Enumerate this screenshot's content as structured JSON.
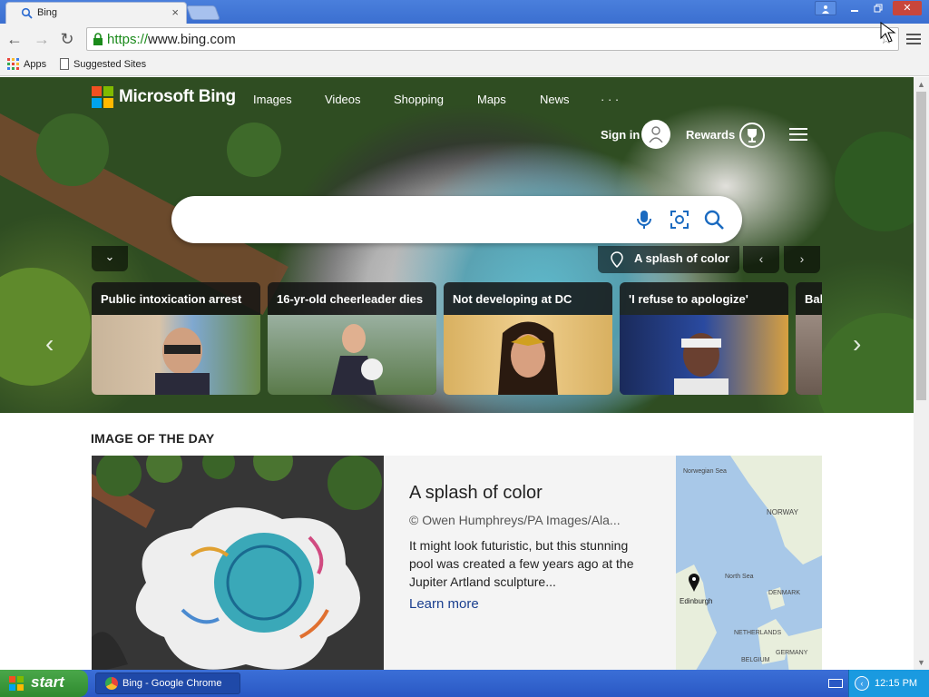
{
  "browser": {
    "tab_title": "Bing",
    "url_scheme": "https://",
    "url_rest": "www.bing.com",
    "bookmarks": [
      "Apps",
      "Suggested Sites"
    ]
  },
  "bing": {
    "brand": "Microsoft Bing",
    "nav": [
      "Images",
      "Videos",
      "Shopping",
      "Maps",
      "News",
      "· · ·"
    ],
    "sign_in": "Sign in",
    "rewards": "Rewards",
    "search_placeholder": "",
    "info_pill": "A splash of color",
    "cards": [
      {
        "title": "Public intoxication arrest"
      },
      {
        "title": "16-yr-old cheerleader dies"
      },
      {
        "title": "Not developing at DC"
      },
      {
        "title": "'I refuse to apologize'"
      },
      {
        "title": "Bab"
      }
    ],
    "section_title": "IMAGE OF THE DAY",
    "iotd": {
      "title": "A splash of color",
      "credit": "© Owen Humphreys/PA Images/Ala...",
      "desc": "It might look futuristic, but this stunning pool was created a few years ago at the Jupiter Artland sculpture...",
      "link": "Learn more",
      "map_labels": [
        "Norwegian Sea",
        "NORWAY",
        "North Sea",
        "Edinburgh",
        "DENMARK",
        "NETHERLANDS",
        "GERMANY",
        "BELGIUM"
      ]
    }
  },
  "taskbar": {
    "start": "start",
    "task": "Bing - Google Chrome",
    "clock": "12:15 PM"
  },
  "colors": {
    "ms_red": "#f25022",
    "ms_green": "#7fba00",
    "ms_blue": "#00a4ef",
    "ms_yellow": "#ffb900",
    "link_blue": "#1a3f8f"
  }
}
